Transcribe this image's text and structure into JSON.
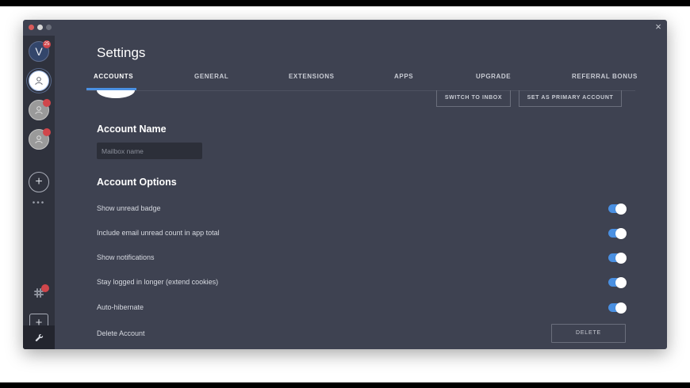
{
  "sidebar": {
    "accounts": [
      {
        "initial": "V",
        "badge": "25"
      },
      {
        "initial": "",
        "badge": ""
      },
      {
        "initial": "",
        "badge": ""
      },
      {
        "initial": "",
        "badge": ""
      }
    ],
    "add_label": "+",
    "add_service_label": "+",
    "icons": {
      "add": "plus-icon",
      "more": "more-dots-icon",
      "slack": "slack-icon",
      "settings": "wrench-icon"
    }
  },
  "window": {
    "close_label": "×"
  },
  "settings": {
    "title": "Settings",
    "tabs": [
      {
        "label": "ACCOUNTS",
        "active": true
      },
      {
        "label": "GENERAL",
        "active": false
      },
      {
        "label": "EXTENSIONS",
        "active": false
      },
      {
        "label": "APPS",
        "active": false
      },
      {
        "label": "UPGRADE",
        "active": false
      },
      {
        "label": "REFERRAL BONUS",
        "active": false
      }
    ],
    "switch_to_inbox_label": "SWITCH TO INBOX",
    "set_primary_label": "SET AS PRIMARY ACCOUNT",
    "account_name_heading": "Account Name",
    "mailbox_placeholder": "Mailbox name",
    "account_options_heading": "Account Options",
    "options": [
      {
        "label": "Show unread badge",
        "on": true
      },
      {
        "label": "Include email unread count in app total",
        "on": true
      },
      {
        "label": "Show notifications",
        "on": true
      },
      {
        "label": "Stay logged in longer (extend cookies)",
        "on": true
      },
      {
        "label": "Auto-hibernate",
        "on": true
      }
    ],
    "delete_account_label": "Delete Account",
    "delete_button_label": "DELETE"
  },
  "colors": {
    "accent": "#4a90e2",
    "badge": "#d0464b",
    "content_bg": "#3e4251",
    "sidebar_bg": "#2f323d"
  }
}
